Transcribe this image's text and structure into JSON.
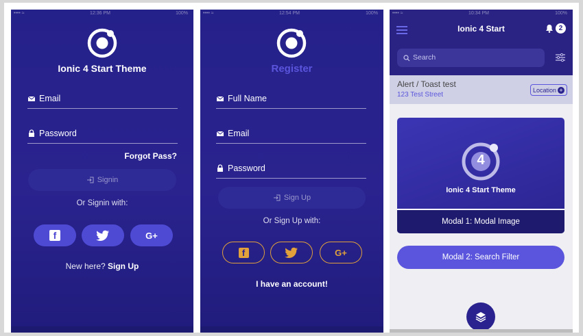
{
  "status": {
    "carrier": "•••• ≈",
    "time_left": "12:36 PM",
    "time_mid": "12:54 PM",
    "time_right": "10:34 PM",
    "battery": "100%"
  },
  "login": {
    "title": "Ionic 4 Start Theme",
    "email_label": "Email",
    "password_label": "Password",
    "forgot_label": "Forgot Pass?",
    "signin_label": "Signin",
    "or_text": "Or Signin with:",
    "new_here": "New here?",
    "signup_link": "Sign Up"
  },
  "register": {
    "title": "Register",
    "fullname_label": "Full Name",
    "email_label": "Email",
    "password_label": "Password",
    "signup_label": "Sign Up",
    "or_text": "Or Sign Up with:",
    "have_account": "I have an account!"
  },
  "home": {
    "header_title": "Ionic 4 Start",
    "notif_count": "2",
    "search_placeholder": "Search",
    "alert_title": "Alert / Toast test",
    "alert_address": "123 Test Street",
    "location_btn": "Location",
    "card_title": "Ionic 4 Start Theme",
    "card_logo_number": "4",
    "modal1_label": "Modal 1: Modal Image",
    "modal2_label": "Modal 2: Search Filter"
  },
  "social": {
    "facebook": "f",
    "google": "G+"
  },
  "colors": {
    "primary_dark": "#2a238f",
    "accent_purple": "#5a55dc",
    "accent_orange": "#e2a13a",
    "link_purple": "#5a55dc"
  }
}
